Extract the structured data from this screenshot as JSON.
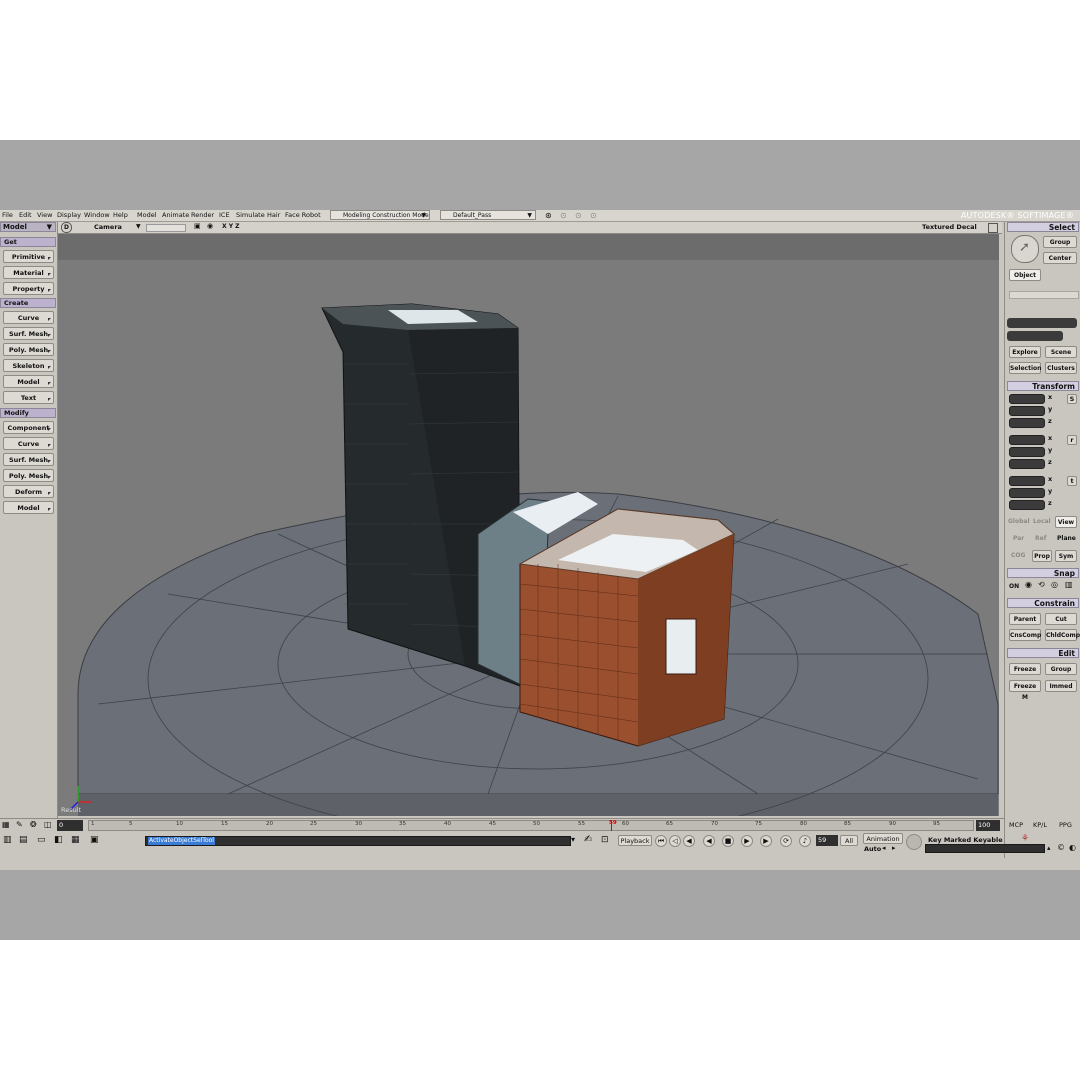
{
  "menubar": {
    "items": [
      "File",
      "Edit",
      "View",
      "Display",
      "Window",
      "Help",
      "Model",
      "Animate",
      "Render",
      "ICE",
      "Simulate",
      "Hair",
      "Face Robot"
    ],
    "mode_dropdown": "Modeling Construction Mode",
    "pass_dropdown": "Default_Pass",
    "brand": "AUTODESK® SOFTIMAGE®"
  },
  "left_panel": {
    "title": "Model",
    "get_label": "Get",
    "get_items": [
      "Primitive",
      "Material",
      "Property"
    ],
    "create_label": "Create",
    "create_items": [
      "Curve",
      "Surf. Mesh",
      "Poly. Mesh",
      "Skeleton",
      "Model",
      "Text"
    ],
    "modify_label": "Modify",
    "modify_items": [
      "Component",
      "Curve",
      "Surf. Mesh",
      "Poly. Mesh",
      "Deform",
      "Model"
    ]
  },
  "viewport": {
    "letter": "D",
    "camera": "Camera",
    "axes": "X Y Z",
    "shading": "Textured Decal",
    "result_label": "Result"
  },
  "right_panel": {
    "select_head": "Select",
    "group": "Group",
    "center": "Center",
    "object": "Object",
    "explore": "Explore",
    "scene": "Scene",
    "selection": "Selection",
    "clusters": "Clusters",
    "transform_head": "Transform",
    "axes": [
      "x",
      "y",
      "z"
    ],
    "scale_icon": "S",
    "rotate_icon": "r",
    "translate_icon": "t",
    "global": "Global",
    "local": "Local",
    "view": "View",
    "par": "Par",
    "ref": "Ref",
    "plane": "Plane",
    "cog": "COG",
    "prop": "Prop",
    "sym": "Sym",
    "snap_head": "Snap",
    "on": "ON",
    "constrain_head": "Constrain",
    "parent": "Parent",
    "cut": "Cut",
    "cnscomp": "CnsComp",
    "chldcomp": "ChldComp",
    "edit_head": "Edit",
    "freeze": "Freeze",
    "edit_group": "Group",
    "freeze_m": "Freeze M",
    "immed": "Immed"
  },
  "timeline": {
    "start": "0",
    "end": "100",
    "ticks": [
      "1",
      "5",
      "10",
      "15",
      "20",
      "25",
      "30",
      "35",
      "40",
      "45",
      "50",
      "55",
      "60",
      "65",
      "70",
      "75",
      "80",
      "85",
      "90",
      "95"
    ],
    "current_frame": "59",
    "current_marker": "59",
    "tabs": [
      "MCP",
      "KP/L",
      "PPG"
    ]
  },
  "controls": {
    "command": "ActivateObjectSelTool",
    "playback": "Playback",
    "frame": "59",
    "all": "All",
    "animation": "Animation",
    "auto": "Auto",
    "key_label": "Key Marked Keyable"
  }
}
